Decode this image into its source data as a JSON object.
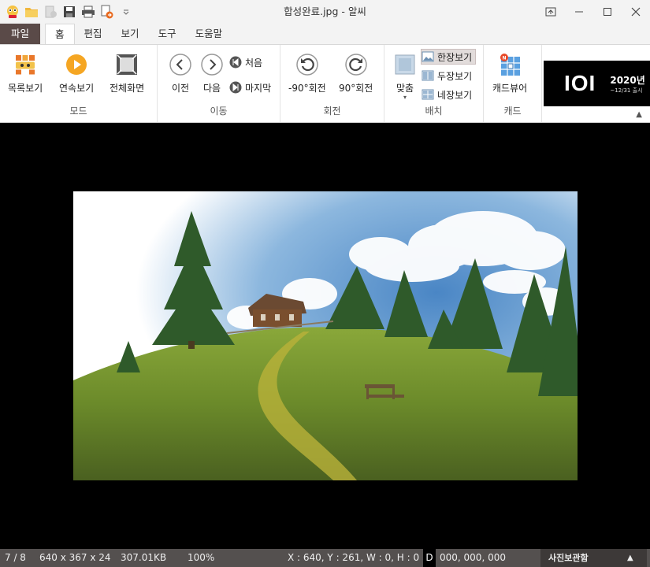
{
  "window": {
    "title": "합성완료.jpg - 알씨"
  },
  "tabs": [
    {
      "label": "파일"
    },
    {
      "label": "홈"
    },
    {
      "label": "편집"
    },
    {
      "label": "보기"
    },
    {
      "label": "도구"
    },
    {
      "label": "도움말"
    }
  ],
  "ribbon": {
    "mode": {
      "label": "모드",
      "list": "목록보기",
      "slideshow": "연속보기",
      "fullscreen": "전체화면"
    },
    "move": {
      "label": "이동",
      "prev": "이전",
      "next": "다음",
      "first": "처음",
      "last": "마지막"
    },
    "rotate": {
      "label": "회전",
      "ccw": "-90°회전",
      "cw": "90°회전"
    },
    "layout": {
      "label": "배치",
      "fit": "맞춤",
      "single": "한장보기",
      "double": "두장보기",
      "quad": "네장보기"
    },
    "cad": {
      "label": "캐드",
      "viewer": "캐드뷰어"
    }
  },
  "ad": {
    "logo": "IOI",
    "line1": "2020년",
    "line2": "~12/31 출시"
  },
  "status": {
    "index": "7 / 8",
    "dims": "640 x 367 x 24",
    "size": "307.01KB",
    "zoom": "100%",
    "coords": "X : 640, Y : 261, W : 0, H : 0",
    "color_tag": "D",
    "color": "000, 000, 000",
    "photo_box": "사진보관함"
  },
  "colors": {
    "accent": "#5a4a48",
    "statusbar": "#54504f"
  }
}
